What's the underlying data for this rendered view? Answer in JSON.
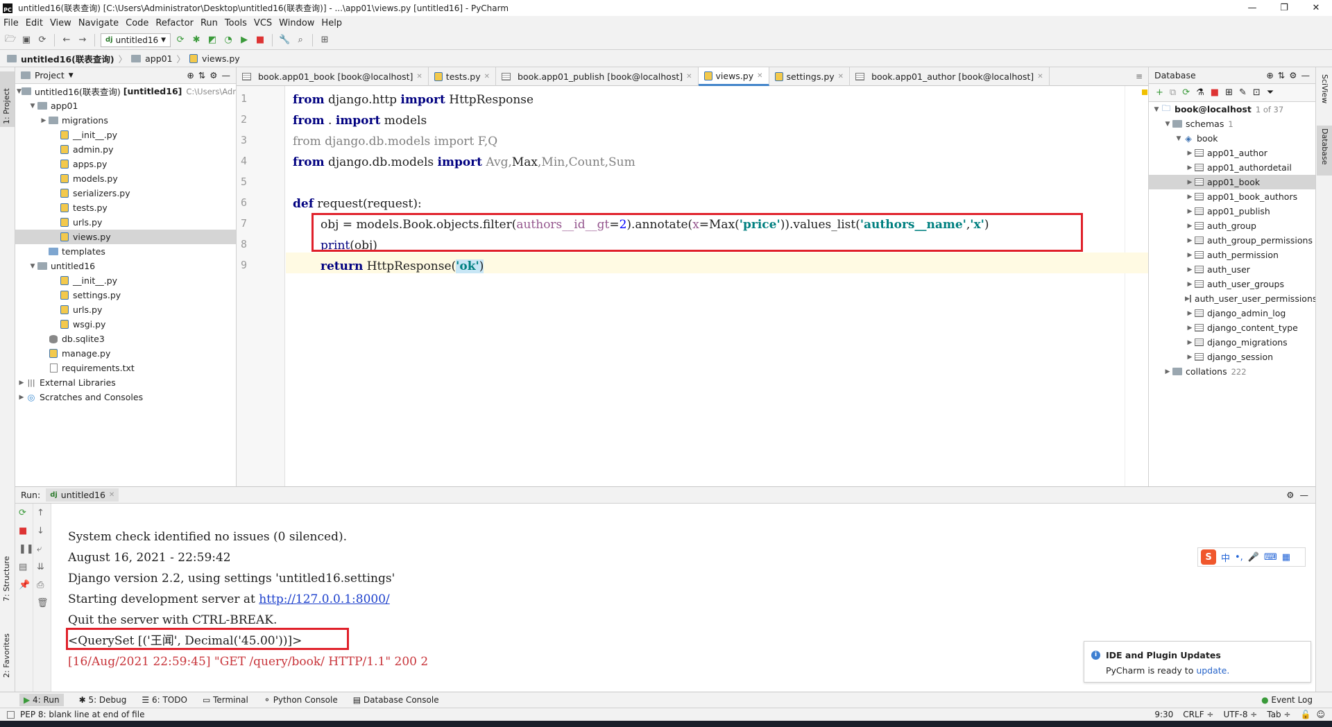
{
  "window": {
    "title": "untitled16(联表查询) [C:\\Users\\Administrator\\Desktop\\untitled16(联表查询)] - ...\\app01\\views.py [untitled16] - PyCharm",
    "minimize": "—",
    "maximize": "❐",
    "close": "✕"
  },
  "menu": [
    "File",
    "Edit",
    "View",
    "Navigate",
    "Code",
    "Refactor",
    "Run",
    "Tools",
    "VCS",
    "Window",
    "Help"
  ],
  "toolbar": {
    "run_config": "untitled16"
  },
  "breadcrumb": [
    "untitled16(联表查询)",
    "app01",
    "views.py"
  ],
  "project": {
    "header": "Project",
    "root_label": "untitled16(联表查询)",
    "root_tag": "[untitled16]",
    "root_path": "C:\\Users\\Admi",
    "items": [
      {
        "label": "app01",
        "type": "folder"
      },
      {
        "label": "migrations",
        "type": "folder"
      },
      {
        "label": "__init__.py",
        "type": "py"
      },
      {
        "label": "admin.py",
        "type": "py"
      },
      {
        "label": "apps.py",
        "type": "py"
      },
      {
        "label": "models.py",
        "type": "py"
      },
      {
        "label": "serializers.py",
        "type": "py"
      },
      {
        "label": "tests.py",
        "type": "py"
      },
      {
        "label": "urls.py",
        "type": "py"
      },
      {
        "label": "views.py",
        "type": "py"
      },
      {
        "label": "templates",
        "type": "folder"
      },
      {
        "label": "untitled16",
        "type": "folder"
      },
      {
        "label": "__init__.py",
        "type": "py"
      },
      {
        "label": "settings.py",
        "type": "py"
      },
      {
        "label": "urls.py",
        "type": "py"
      },
      {
        "label": "wsgi.py",
        "type": "py"
      },
      {
        "label": "db.sqlite3",
        "type": "db"
      },
      {
        "label": "manage.py",
        "type": "py"
      },
      {
        "label": "requirements.txt",
        "type": "txt"
      },
      {
        "label": "External Libraries",
        "type": "lib"
      },
      {
        "label": "Scratches and Consoles",
        "type": "scratch"
      }
    ]
  },
  "tabs": [
    {
      "label": "book.app01_book [book@localhost]"
    },
    {
      "label": "tests.py"
    },
    {
      "label": "book.app01_publish [book@localhost]"
    },
    {
      "label": "views.py"
    },
    {
      "label": "settings.py"
    },
    {
      "label": "book.app01_author [book@localhost]"
    }
  ],
  "editor": {
    "line_numbers": [
      "1",
      "2",
      "3",
      "4",
      "5",
      "6",
      "7",
      "8",
      "9"
    ],
    "line1": {
      "a": "from",
      "b": " django.http ",
      "c": "import",
      "d": " HttpResponse"
    },
    "line2": {
      "a": "from",
      "b": " . ",
      "c": "import",
      "d": " models"
    },
    "line3": "from django.db.models import F,Q",
    "line4": {
      "a": "from",
      "b": " django.db.models ",
      "c": "import",
      "d": " Avg,",
      "e": "Max",
      "f": ",Min,Count,Sum"
    },
    "line6": {
      "a": "def",
      "b": " request(request):"
    },
    "line7": {
      "a": "obj = models.Book.objects.filter(",
      "b": "authors__id__gt",
      "c": "=",
      "d": "2",
      "e": ").annotate(",
      "f": "x",
      "g": "=Max(",
      "h": "'price'",
      "i": ")).values_list(",
      "j": "'authors__name'",
      "k": ",",
      "l": "'x'",
      "m": ")"
    },
    "line8": {
      "a": "print",
      "b": "(obj)"
    },
    "line9": {
      "a": "return",
      "b": " HttpResponse(",
      "c": "'ok'",
      "d": ")"
    }
  },
  "database": {
    "header": "Database",
    "connection": "book@localhost",
    "connection_count": "1 of 37",
    "schemas_label": "schemas",
    "schemas_count": "1",
    "schema": "book",
    "tables": [
      "app01_author",
      "app01_authordetail",
      "app01_book",
      "app01_book_authors",
      "app01_publish",
      "auth_group",
      "auth_group_permissions",
      "auth_permission",
      "auth_user",
      "auth_user_groups",
      "auth_user_user_permissions",
      "django_admin_log",
      "django_content_type",
      "django_migrations",
      "django_session"
    ],
    "collations_label": "collations",
    "collations_count": "222"
  },
  "run": {
    "label": "Run:",
    "config_tab": "untitled16",
    "console": [
      "System check identified no issues (0 silenced).",
      "August 16, 2021 - 22:59:42",
      "Django version 2.2, using settings 'untitled16.settings'",
      "Starting development server at ",
      "Quit the server with CTRL-BREAK.",
      "<QuerySet [('王闻', Decimal('45.00'))]>",
      "[16/Aug/2021 22:59:45] \"GET /query/book/ HTTP/1.1\" 200 2"
    ],
    "server_url": "http://127.0.0.1:8000/"
  },
  "notification": {
    "title": "IDE and Plugin Updates",
    "body": "PyCharm is ready to ",
    "link": "update."
  },
  "ime": {
    "logo": "S",
    "mode": "中"
  },
  "tool_windows": [
    "4: Run",
    "5: Debug",
    "6: TODO",
    "Terminal",
    "Python Console",
    "Database Console"
  ],
  "event_log": "Event Log",
  "left_stripe": {
    "project": "1: Project",
    "structure": "7: Structure",
    "favorites": "2: Favorites"
  },
  "right_stripe": {
    "sciview": "SciView",
    "database": "Database"
  },
  "status": {
    "message": "PEP 8: blank line at end of file",
    "position": "9:30",
    "line_sep": "CRLF ÷",
    "encoding": "UTF-8 ÷",
    "indent": "Tab ÷"
  }
}
